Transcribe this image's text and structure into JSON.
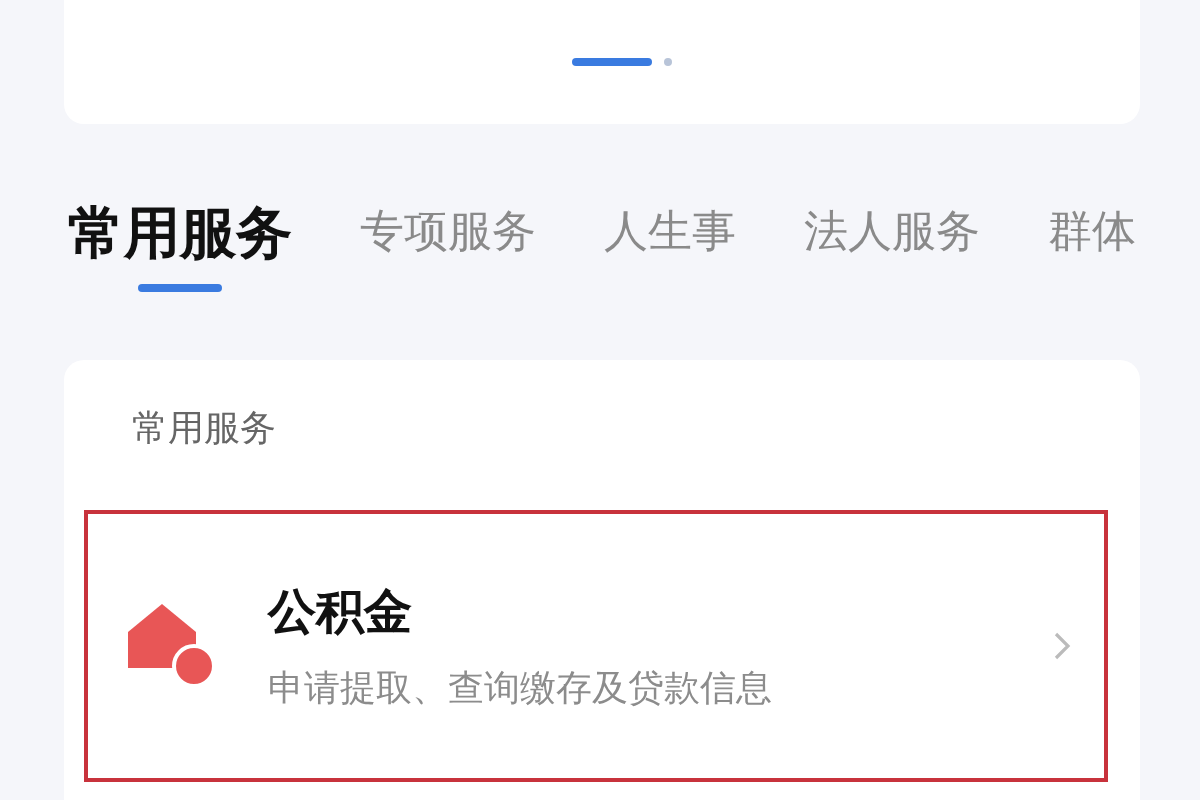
{
  "pager": [
    {
      "selected": true
    },
    {
      "selected": false
    }
  ],
  "tabs": [
    {
      "label": "常用服务",
      "selected": true
    },
    {
      "label": "专项服务",
      "selected": false
    },
    {
      "label": "人生事",
      "selected": false
    },
    {
      "label": "法人服务",
      "selected": false
    },
    {
      "label": "群体",
      "selected": false
    }
  ],
  "section": {
    "title": "常用服务",
    "items": [
      {
        "title": "公积金",
        "subtitle": "申请提取、查询缴存及贷款信息",
        "highlighted": true
      }
    ]
  }
}
